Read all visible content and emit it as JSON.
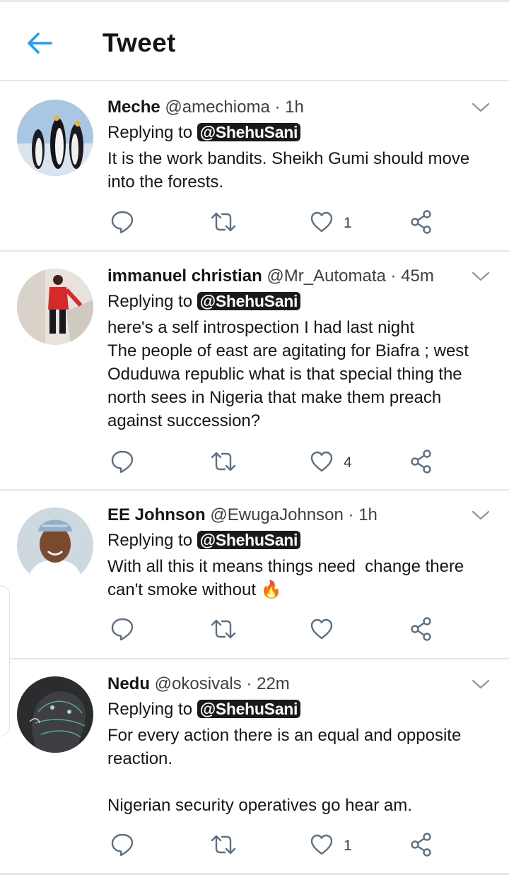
{
  "header": {
    "title": "Tweet",
    "back_icon": "arrow-left-icon",
    "accent_color": "#1da1f2"
  },
  "tweets": [
    {
      "name": "Meche",
      "handle": "@amechioma",
      "dot": "·",
      "time": "1h",
      "replying_label": "Replying to",
      "mention": "@ShehuSani",
      "text": "It is the work bandits. Sheikh Gumi should move into the forests.",
      "likes": "1",
      "avatar": "penguins-photo"
    },
    {
      "name": "immanuel christian",
      "handle": "@Mr_Automata",
      "dot": "·",
      "time": "45m",
      "replying_label": "Replying to",
      "mention": "@ShehuSani",
      "text": "here's a self introspection I had last night\nThe people of east are agitating for Biafra ; west Oduduwa republic what is that special thing the north sees in Nigeria that make them preach against succession?",
      "likes": "4",
      "avatar": "man-red-shirt-photo"
    },
    {
      "name": "EE Johnson",
      "handle": "@EwugaJohnson",
      "dot": "·",
      "time": "1h",
      "replying_label": "Replying to",
      "mention": "@ShehuSani",
      "text": "With all this it means things need  change there can't smoke without 🔥",
      "likes": "",
      "avatar": "man-cap-photo"
    },
    {
      "name": "Nedu",
      "handle": "@okosivals",
      "dot": "·",
      "time": "22m",
      "replying_label": "Replying to",
      "mention": "@ShehuSani",
      "text": "For every action there is an equal and opposite reaction.\n\nNigerian security operatives go hear am.",
      "likes": "1",
      "avatar": "head-chalk-drawing"
    }
  ]
}
